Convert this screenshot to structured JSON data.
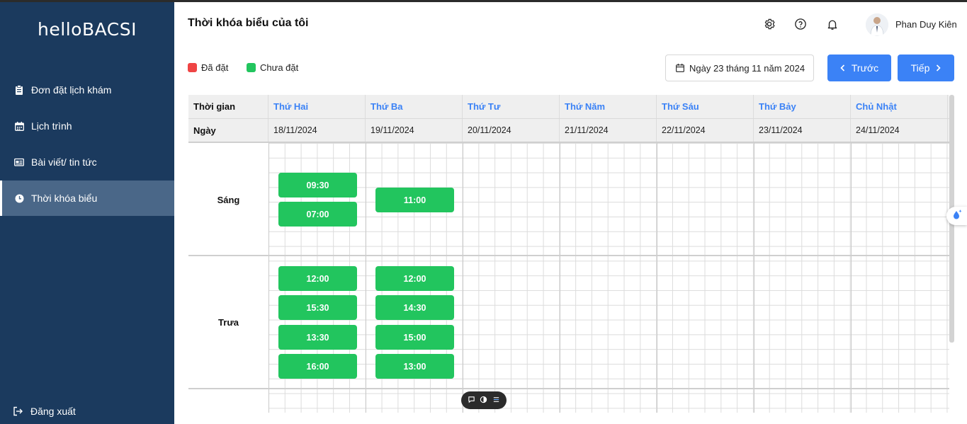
{
  "app": {
    "logo": "helloBACSI",
    "page_title": "Thời khóa biểu của tôi",
    "user_name": "Phan Duy Kiên"
  },
  "sidebar": {
    "items": [
      {
        "label": "Đơn đặt lịch khám",
        "icon": "clipboard-icon"
      },
      {
        "label": "Lịch trình",
        "icon": "calendar-icon"
      },
      {
        "label": "Bài viết/ tin tức",
        "icon": "newspaper-icon"
      },
      {
        "label": "Thời khóa biểu",
        "icon": "clock-icon",
        "active": true
      }
    ],
    "logout_label": "Đăng xuất"
  },
  "legend": {
    "booked": {
      "label": "Đã đặt",
      "color": "#ef4444"
    },
    "available": {
      "label": "Chưa đặt",
      "color": "#22c55e"
    }
  },
  "toolbar": {
    "date_label": "Ngày 23 tháng 11 năm 2024",
    "prev_label": "Trước",
    "next_label": "Tiếp"
  },
  "schedule": {
    "time_header": "Thời gian",
    "date_header": "Ngày",
    "days": [
      {
        "name": "Thứ Hai",
        "date": "18/11/2024"
      },
      {
        "name": "Thứ Ba",
        "date": "19/11/2024"
      },
      {
        "name": "Thứ Tư",
        "date": "20/11/2024"
      },
      {
        "name": "Thứ Năm",
        "date": "21/11/2024"
      },
      {
        "name": "Thứ Sáu",
        "date": "22/11/2024"
      },
      {
        "name": "Thứ Bảy",
        "date": "23/11/2024"
      },
      {
        "name": "Chủ Nhật",
        "date": "24/11/2024"
      }
    ],
    "periods": {
      "morning": "Sáng",
      "noon": "Trưa"
    },
    "slots": {
      "morning_mon": [
        "09:30",
        "07:00"
      ],
      "morning_tue": [
        "11:00"
      ],
      "noon_mon": [
        "12:00",
        "15:30",
        "13:30",
        "16:00"
      ],
      "noon_tue": [
        "12:00",
        "14:30",
        "15:00",
        "13:00"
      ]
    }
  },
  "colors": {
    "sidebar_bg": "#1b3a5e",
    "accent": "#3b82f6",
    "slot_available": "#22c55e"
  }
}
